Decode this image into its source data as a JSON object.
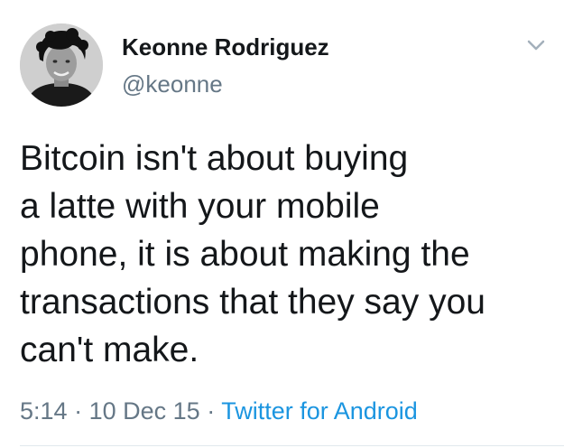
{
  "author": {
    "display_name": "Keonne Rodriguez",
    "handle": "@keonne",
    "avatar_icon": "user-avatar"
  },
  "menu": {
    "icon": "chevron-down-icon"
  },
  "tweet": {
    "lines": [
      "Bitcoin isn't about buying",
      "a latte with your mobile",
      "phone, it is about making the",
      "transactions that they say you",
      "can't make."
    ]
  },
  "meta": {
    "time": "5:14",
    "separator": "·",
    "date": "10 Dec 15",
    "source": "Twitter for Android"
  },
  "colors": {
    "text": "#14171a",
    "secondary": "#657786",
    "link": "#1b95e0",
    "divider": "#e1e8ed"
  }
}
